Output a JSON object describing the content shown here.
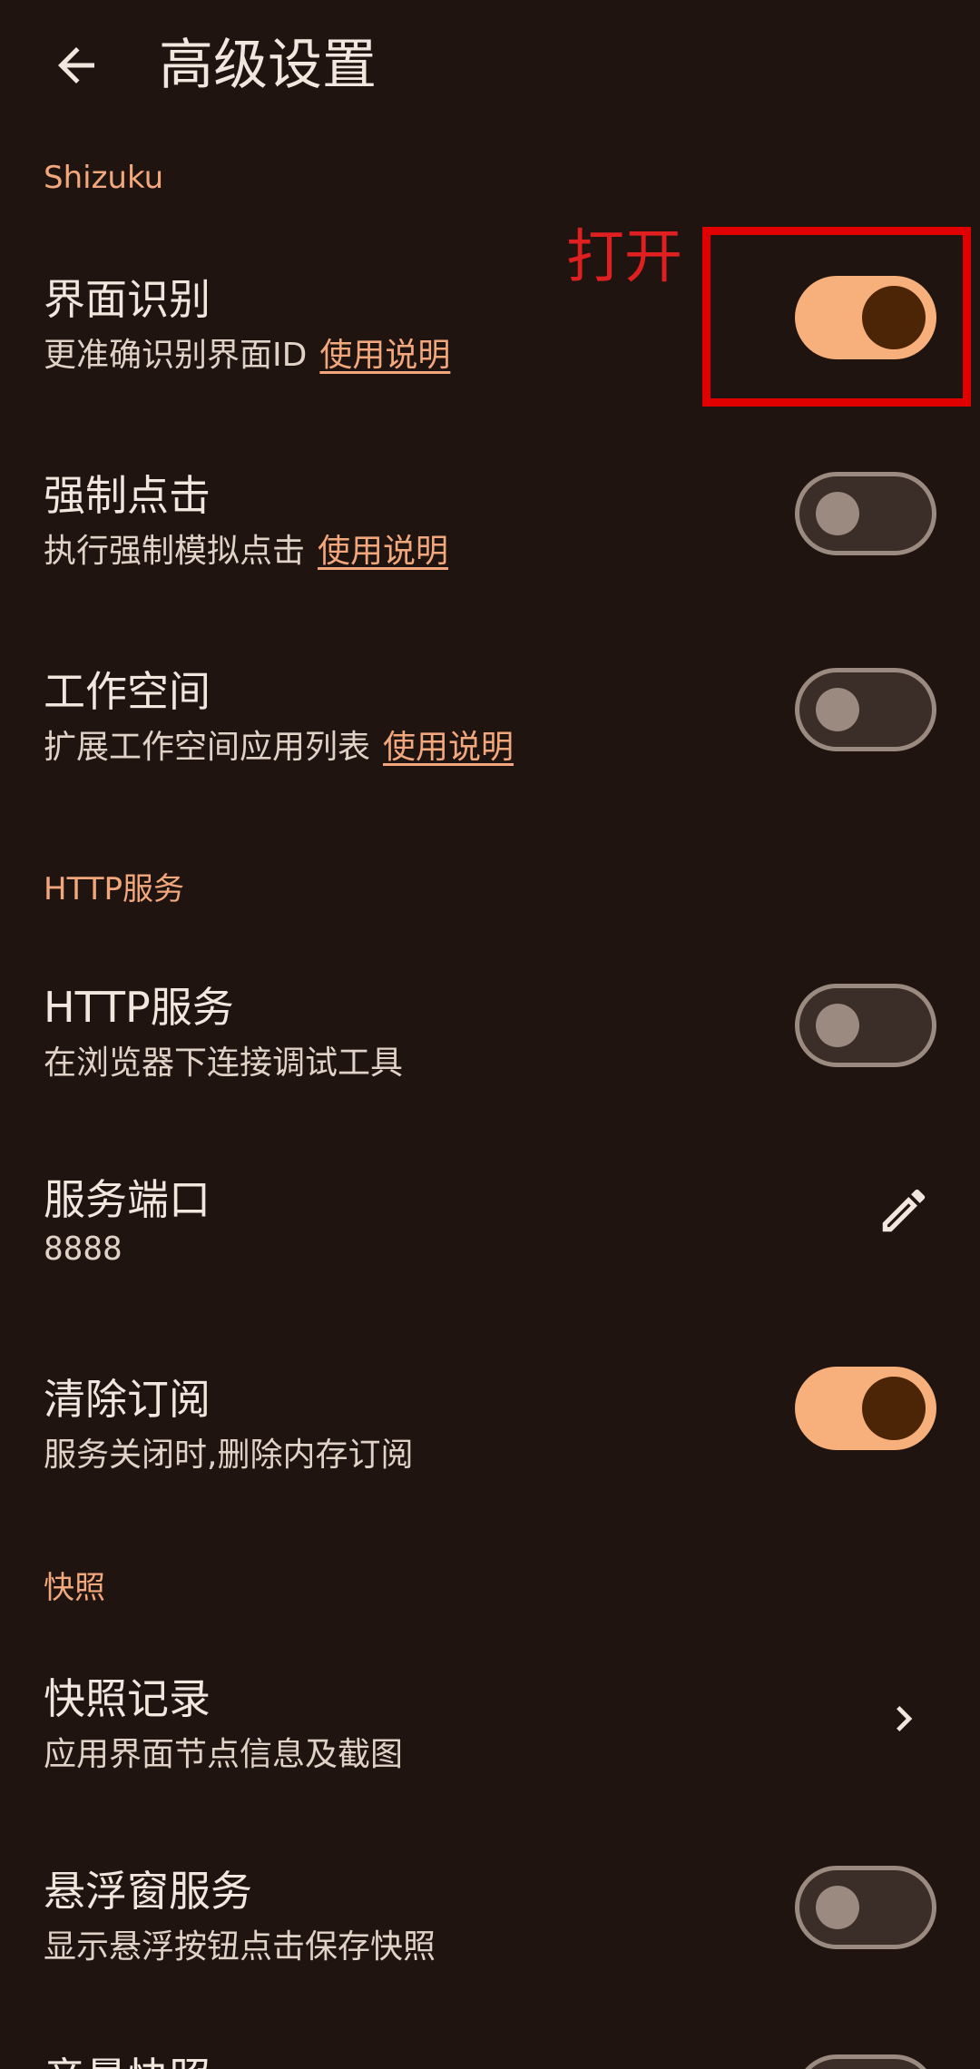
{
  "header": {
    "title": "高级设置"
  },
  "sections": {
    "shizuku": "Shizuku",
    "http": "HTTP服务",
    "snapshot": "快照"
  },
  "annotation": {
    "label": "打开"
  },
  "rows": {
    "ui_recognition": {
      "title": "界面识别",
      "subtitle": "更准确识别界面ID",
      "link": "使用说明",
      "toggle": true
    },
    "force_click": {
      "title": "强制点击",
      "subtitle": "执行强制模拟点击",
      "link": "使用说明",
      "toggle": false
    },
    "workspace": {
      "title": "工作空间",
      "subtitle": "扩展工作空间应用列表",
      "link": "使用说明",
      "toggle": false
    },
    "http_service": {
      "title": "HTTP服务",
      "subtitle": "在浏览器下连接调试工具",
      "toggle": false
    },
    "service_port": {
      "title": "服务端口",
      "value": "8888",
      "icon": "edit-icon"
    },
    "clear_subscription": {
      "title": "清除订阅",
      "subtitle": "服务关闭时,删除内存订阅",
      "toggle": true
    },
    "snapshot_records": {
      "title": "快照记录",
      "subtitle": "应用界面节点信息及截图",
      "icon": "chevron-right-icon"
    },
    "floating_window": {
      "title": "悬浮窗服务",
      "subtitle": "显示悬浮按钮点击保存快照",
      "toggle": false
    },
    "partial_next": {
      "title": "音量快照"
    }
  },
  "colors": {
    "background": "#1f1410",
    "accent": "#f3a77c",
    "switch_on": "#f7b07b",
    "switch_knob_on": "#4c2507",
    "annotation": "#e00000"
  }
}
